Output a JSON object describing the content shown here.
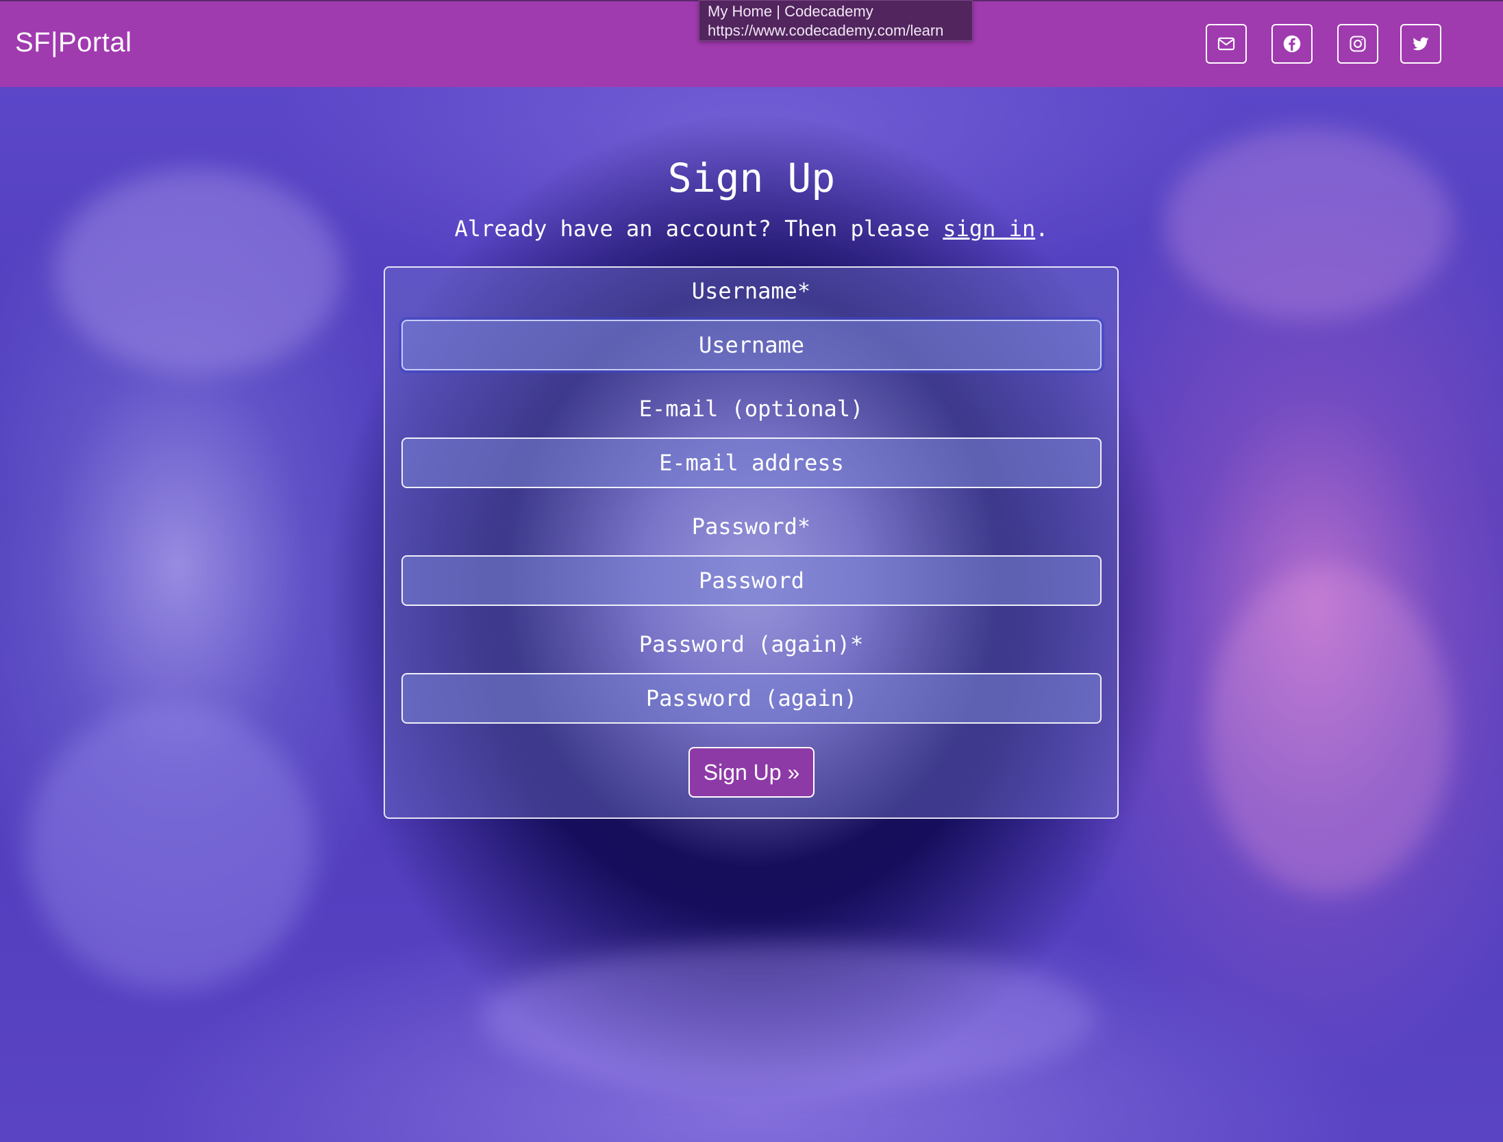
{
  "navbar": {
    "brand": "SF|Portal",
    "background_color": "#a03aaf",
    "social_icons": [
      "envelope-icon",
      "facebook-icon",
      "instagram-icon",
      "twitter-icon"
    ]
  },
  "tooltip": {
    "title": "My Home | Codecademy",
    "url": "https://www.codecademy.com/learn"
  },
  "page": {
    "title": "Sign Up",
    "subtitle_prefix": "Already have an account? Then please ",
    "signin_link": "sign in",
    "subtitle_suffix": "."
  },
  "form": {
    "username": {
      "label": "Username*",
      "placeholder": "Username"
    },
    "email": {
      "label": "E-mail (optional)",
      "placeholder": "E-mail address"
    },
    "password": {
      "label": "Password*",
      "placeholder": "Password"
    },
    "password_again": {
      "label": "Password (again)*",
      "placeholder": "Password (again)"
    },
    "submit_label": "Sign Up »",
    "submit_color": "#8e3aa6"
  }
}
